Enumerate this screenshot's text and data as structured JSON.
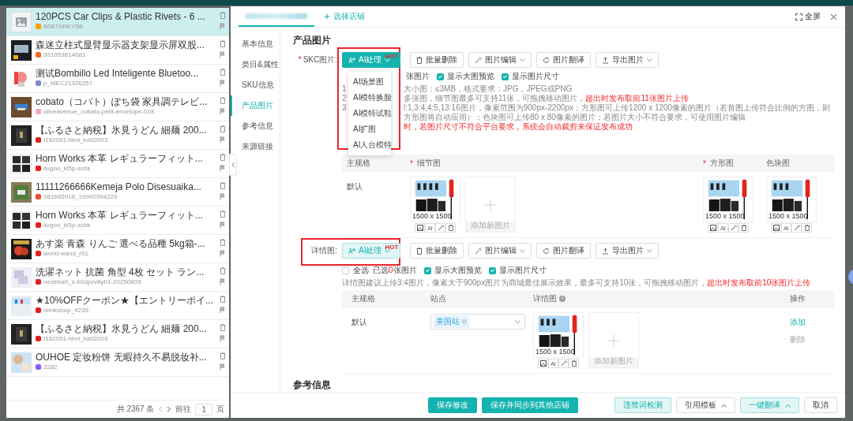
{
  "product_list": {
    "items": [
      {
        "kind": "placeholder",
        "selected": true,
        "title": "120PCS Car Clips & Plastic Rivets - 6 ...",
        "shop": "B087XRKY5B",
        "color": "#ff9900"
      },
      {
        "kind": "picture",
        "selected": false,
        "title": "森迷立柱式显臂显示器支架显示屏双股...",
        "shop": "951053814681",
        "color": "#f26a21"
      },
      {
        "kind": "picture",
        "selected": false,
        "title": "测试Bombillo Led Inteligente Bluetoo...",
        "shop": "p_MEC21326257",
        "color": "#7b8cc9"
      },
      {
        "kind": "picture",
        "selected": false,
        "title": "cobato（コバト）ぽち袋 家具調テレビ...",
        "shop": "oliveavenue_cobato-petit-envelope-018",
        "color": "#f5a3c7"
      },
      {
        "kind": "picture",
        "selected": false,
        "title": "【ふるさと納税】氷見うどん 細麺 200...",
        "shop": "f162051-himi_ka02003",
        "color": "#e02020"
      },
      {
        "kind": "picture",
        "selected": false,
        "title": "Horn Works 本革 レギュラーフィット...",
        "shop": "liugoo_ki5p-scbk",
        "color": "#e02020"
      },
      {
        "kind": "picture",
        "selected": false,
        "title": "11111266666Kemeja Polo Disesuaika...",
        "shop": "981685918_19992994229",
        "color": "#ee4d2d"
      },
      {
        "kind": "picture",
        "selected": false,
        "title": "Horn Works 本革 レギュラーフィット...",
        "shop": "liugoo_ki5p-scbk",
        "color": "#e02020"
      },
      {
        "kind": "picture",
        "selected": false,
        "title": "あす楽 青森 りんご 選べる品種 5kg箱-...",
        "shop": "world-wand_r01",
        "color": "#e02020"
      },
      {
        "kind": "picture",
        "selected": false,
        "title": "洗濯ネット 抗菌 角型 4枚 セット ラン...",
        "shop": "nextmart_s-b0dpzv8yh1-20250805",
        "color": "#e02020"
      },
      {
        "kind": "picture",
        "selected": false,
        "title": "★10%OFFクーポン★【エントリーポイ...",
        "shop": "drinkshop_4239",
        "color": "#e02020"
      },
      {
        "kind": "picture",
        "selected": false,
        "title": "【ふるさと納税】氷見うどん 細麺 200...",
        "shop": "f162051-himi_ka02003",
        "color": "#e02020"
      },
      {
        "kind": "picture",
        "selected": false,
        "title": "OUHOE 定妆粉饼 无暇持久不易脱妆补...",
        "shop": "3282",
        "color": "#8b5cf6"
      }
    ],
    "total": "共 2367 条",
    "goto_label": "前往",
    "page": "1",
    "page_unit": "页"
  },
  "header": {
    "store_link": "选择店铺",
    "fullscreen": "全屏"
  },
  "nav": [
    {
      "label": "基本信息",
      "selected": false
    },
    {
      "label": "类目&属性",
      "selected": false
    },
    {
      "label": "SKU信息",
      "selected": false
    },
    {
      "label": "产品图片",
      "selected": true
    },
    {
      "label": "参考信息",
      "selected": false
    },
    {
      "label": "来源链接",
      "selected": false
    }
  ],
  "heading": "产品图片",
  "skc": {
    "label": "SKC图片:",
    "mark": "*",
    "toolbar": [
      {
        "kind": "ai",
        "label": "AI处理",
        "badge": "HOT",
        "expanded": true
      },
      {
        "kind": "delete",
        "label": "批量删除"
      },
      {
        "kind": "edit",
        "label": "图片编辑"
      },
      {
        "kind": "translate",
        "label": "图片翻译"
      },
      {
        "kind": "export",
        "label": "导出图片"
      }
    ],
    "ai_menu": [
      "AI场景图",
      "AI模特换脸",
      "AI模特试鞋",
      "AI扩图",
      "AI人台模特"
    ],
    "selection_fragment": "张图片",
    "options": [
      {
        "label": "显示大图预览",
        "checked": true
      },
      {
        "label": "显示图片尺寸",
        "checked": true
      }
    ],
    "hints": [
      {
        "lead": "1",
        "parts": [
          {
            "text": "大小图：≤3MB，格式要求：JPG，JPEG或PNG",
            "alert": false
          }
        ]
      },
      {
        "lead": "2",
        "parts": [
          {
            "text": "多张图，细节图最多可支持11张，可拖拽移动图片，",
            "alert": false
          },
          {
            "text": "超出时发布取前11张图片上传",
            "alert": true
          }
        ]
      },
      {
        "lead": "3",
        "parts": [
          {
            "text": "l:1,3:4,4:5,13:16图片，像素范围为900px-2200px；方形图可上传1200 x 1200像素的图片（若首图上传符合比例的方图，则方形图将自动应用）；色块图可上传80 x 80像素的图片；若图片大小不符合要求，可使用图片编辑",
            "alert": false
          }
        ]
      },
      {
        "parts": [
          {
            "text": "时，若图片尺寸不符合平台要求，系统会自动裁剪来保证发布成功",
            "alert": true
          }
        ]
      }
    ],
    "columns": [
      {
        "label": "主规格"
      },
      {
        "label": "细节图",
        "mark": "*"
      },
      {
        "label": "方形图",
        "mark": "*"
      },
      {
        "label": "色块图"
      }
    ],
    "row": {
      "spec": "默认",
      "add_label": "添加新图片",
      "detail_images": [
        {
          "size": "1500 x 1500",
          "ai_tool": "AI"
        }
      ],
      "square_image": {
        "size": "1500 x 1500",
        "ai_tool": "AI"
      },
      "swatch_image": {
        "size": "1500 x 1500",
        "ai_tool": "AI"
      }
    }
  },
  "detail": {
    "label": "详情图:",
    "toolbar": [
      {
        "kind": "ai",
        "label": "AI处理",
        "badge": "HOT",
        "expanded": false
      },
      {
        "kind": "delete",
        "label": "批量删除"
      },
      {
        "kind": "edit",
        "label": "图片编辑"
      },
      {
        "kind": "translate",
        "label": "图片翻译"
      },
      {
        "kind": "export",
        "label": "导出图片"
      }
    ],
    "select_all": {
      "label": "全选",
      "checked": false
    },
    "selected_count": {
      "prefix": "已选",
      "count": "0",
      "suffix": "张图片"
    },
    "options": [
      {
        "label": "显示大图预览",
        "checked": true
      },
      {
        "label": "显示图片尺寸",
        "checked": true
      }
    ],
    "hint": [
      {
        "text": "详情图建议上传3:4图片，像素大于900px图片为商城最佳展示效果，最多可支持10张，可拖拽移动图片，",
        "alert": false
      },
      {
        "text": "超出时发布取前10张图片上传",
        "alert": true
      }
    ],
    "columns": [
      {
        "label": "主规格"
      },
      {
        "label": "站点"
      },
      {
        "label": "详情图",
        "help": true
      },
      {
        "label": "操作"
      }
    ],
    "row": {
      "spec": "默认",
      "site_tag": "美国站",
      "add_label": "添加新图片",
      "images": [
        {
          "size": "1500 x 1500",
          "ai_tool": "AI"
        }
      ],
      "actions": [
        {
          "kind": "add",
          "label": "添加"
        },
        {
          "kind": "delete",
          "label": "删除"
        }
      ]
    }
  },
  "next_heading": "参考信息",
  "footer_buttons": [
    {
      "kind": "primary",
      "label": "保存修改"
    },
    {
      "kind": "primary",
      "label": "保存并同步到其他店铺"
    },
    {
      "kind": "light",
      "label": "违禁词检测"
    },
    {
      "kind": "default",
      "label": "引用模板",
      "caret": true
    },
    {
      "kind": "light",
      "label": "一键翻译",
      "caret": true
    },
    {
      "kind": "default",
      "label": "取消"
    }
  ]
}
